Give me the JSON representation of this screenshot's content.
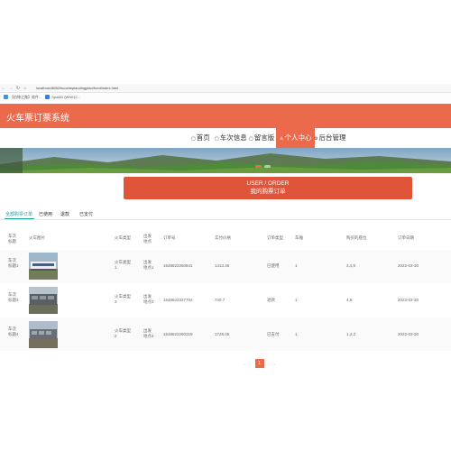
{
  "browser": {
    "url": "localhost:8080/huochepiaodingpiao/front/index.html",
    "bookmarks": [
      "【伯坤之路】软件...",
      "SpaDD (WHE)2..."
    ]
  },
  "site": {
    "title": "火车票订票系统"
  },
  "menu": [
    {
      "icon": "▢",
      "label": "首页"
    },
    {
      "icon": "▢",
      "label": "车次信息"
    },
    {
      "icon": "▢",
      "label": "留言版"
    },
    {
      "icon": "♙",
      "label": "个人中心"
    },
    {
      "icon": "⚙",
      "label": "后台管理"
    }
  ],
  "order_banner": {
    "en": "USER / ORDER",
    "cn": "我的购票订单"
  },
  "tabs": [
    "全部购票订单",
    "已使用",
    "退款",
    "已支付"
  ],
  "table": {
    "headers": [
      "车次\n标题",
      "火车图片",
      "火车类型",
      "出发\n地点",
      "订单号",
      "实付价格",
      "订单类型",
      "车厢",
      "购买的座位",
      "订单日期"
    ],
    "rows": [
      {
        "title": "车次\n标题1",
        "type": "火车类型\n1",
        "from": "出发\n地点1",
        "order_no": "1648622250841",
        "price": "1413.46",
        "status": "已使用",
        "car": "1",
        "seats": "3,4,5",
        "date": "2022-03-30"
      },
      {
        "title": "车次\n标题3",
        "type": "火车类型\n3",
        "from": "出发\n地点3",
        "order_no": "1648622327704",
        "price": "740.7",
        "status": "退款",
        "car": "1",
        "seats": "4,5",
        "date": "2022-03-30"
      },
      {
        "title": "车次\n标题4",
        "type": "火车类型\n2",
        "from": "出发\n地点4",
        "order_no": "1648622260219",
        "price": "1728.05",
        "status": "已支付",
        "car": "1",
        "seats": "1,2,3",
        "date": "2022-03-30"
      }
    ]
  },
  "pager": {
    "prev": "<",
    "current": "1",
    "next": ">"
  },
  "colors": {
    "brand": "#ec6a4c",
    "tab_active": "#17a2a2"
  }
}
